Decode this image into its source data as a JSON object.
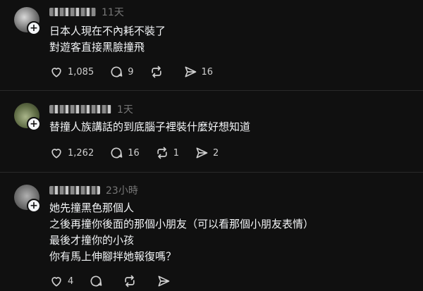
{
  "posts": [
    {
      "time": "11天",
      "lines": [
        "日本人現在不內耗不裝了",
        "對遊客直接黑臉撞飛"
      ],
      "likes": "1,085",
      "replies": "9",
      "reposts": "",
      "shares": "16"
    },
    {
      "time": "1天",
      "lines": [
        "替撞人族講話的到底腦子裡裝什麼好想知道"
      ],
      "likes": "1,262",
      "replies": "16",
      "reposts": "1",
      "shares": "2"
    },
    {
      "time": "23小時",
      "lines": [
        "她先撞黑色那個人",
        "之後再撞你後面的那個小朋友（可以看那個小朋友表情）",
        "最後才撞你的小孩",
        "你有馬上伸腳拌她報復嗎？"
      ],
      "likes": "4",
      "replies": "",
      "reposts": "",
      "shares": ""
    }
  ],
  "icons": {
    "like": "heart-icon",
    "reply": "comment-icon",
    "repost": "repost-icon",
    "share": "send-icon",
    "follow": "plus-icon"
  },
  "colors": {
    "background": "#101010",
    "text": "#f3f5f7",
    "muted": "#777777"
  }
}
